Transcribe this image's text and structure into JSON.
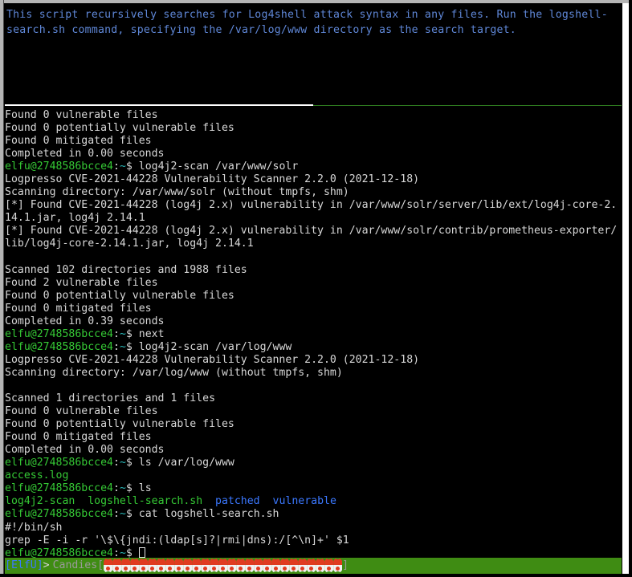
{
  "window": {
    "background_color": "#000000",
    "frame_color": "#b4b4b4",
    "scrollbar_color": "#ffffff"
  },
  "banner": {
    "text": "This script recursively searches for Log4shell attack syntax in any files. Run the logshell-search.sh command, specifying the /var/log/www directory as the search target.",
    "color": "#5f87d7"
  },
  "divider": {
    "left_color": "#ffffff",
    "right_color": "#2f7d20"
  },
  "terminal": {
    "prompt": {
      "user_host": "elfu@2748586bcce4",
      "colon": ":",
      "tilde": "~",
      "dollar": "$ ",
      "user_host_color": "#35c935",
      "tilde_color": "#29b8b8"
    },
    "lines": [
      {
        "type": "out",
        "text": "Found 0 vulnerable files"
      },
      {
        "type": "out",
        "text": "Found 0 potentially vulnerable files"
      },
      {
        "type": "out",
        "text": "Found 0 mitigated files"
      },
      {
        "type": "out",
        "text": "Completed in 0.00 seconds"
      },
      {
        "type": "prompt",
        "command": "log4j2-scan /var/www/solr"
      },
      {
        "type": "out",
        "text": "Logpresso CVE-2021-44228 Vulnerability Scanner 2.2.0 (2021-12-18)"
      },
      {
        "type": "out",
        "text": "Scanning directory: /var/www/solr (without tmpfs, shm)"
      },
      {
        "type": "out",
        "text": "[*] Found CVE-2021-44228 (log4j 2.x) vulnerability in /var/www/solr/server/lib/ext/log4j-core-2.14.1.jar, log4j 2.14.1"
      },
      {
        "type": "out",
        "text": "[*] Found CVE-2021-44228 (log4j 2.x) vulnerability in /var/www/solr/contrib/prometheus-exporter/lib/log4j-core-2.14.1.jar, log4j 2.14.1"
      },
      {
        "type": "blank",
        "text": ""
      },
      {
        "type": "out",
        "text": "Scanned 102 directories and 1988 files"
      },
      {
        "type": "out",
        "text": "Found 2 vulnerable files"
      },
      {
        "type": "out",
        "text": "Found 0 potentially vulnerable files"
      },
      {
        "type": "out",
        "text": "Found 0 mitigated files"
      },
      {
        "type": "out",
        "text": "Completed in 0.39 seconds"
      },
      {
        "type": "prompt",
        "command": "next"
      },
      {
        "type": "prompt",
        "command": "log4j2-scan /var/log/www"
      },
      {
        "type": "out",
        "text": "Logpresso CVE-2021-44228 Vulnerability Scanner 2.2.0 (2021-12-18)"
      },
      {
        "type": "out",
        "text": "Scanning directory: /var/log/www (without tmpfs, shm)"
      },
      {
        "type": "blank",
        "text": ""
      },
      {
        "type": "out",
        "text": "Scanned 1 directories and 1 files"
      },
      {
        "type": "out",
        "text": "Found 0 vulnerable files"
      },
      {
        "type": "out",
        "text": "Found 0 potentially vulnerable files"
      },
      {
        "type": "out",
        "text": "Found 0 mitigated files"
      },
      {
        "type": "out",
        "text": "Completed in 0.00 seconds"
      },
      {
        "type": "prompt",
        "command": "ls /var/log/www"
      },
      {
        "type": "ls",
        "entries": [
          {
            "name": "access.log",
            "kind": "file-green"
          }
        ]
      },
      {
        "type": "prompt",
        "command": "ls"
      },
      {
        "type": "ls",
        "entries": [
          {
            "name": "log4j2-scan",
            "kind": "file-green"
          },
          {
            "name": "logshell-search.sh",
            "kind": "file-green"
          },
          {
            "name": "patched",
            "kind": "dir-blue"
          },
          {
            "name": "vulnerable",
            "kind": "dir-blue"
          }
        ]
      },
      {
        "type": "prompt",
        "command": "cat logshell-search.sh"
      },
      {
        "type": "out",
        "text": "#!/bin/sh"
      },
      {
        "type": "out",
        "text": "grep -E -i -r '\\$\\{jndi:(ldap[s]?|rmi|dns):/[^\\n]+' $1"
      },
      {
        "type": "prompt-cursor",
        "command": ""
      }
    ]
  },
  "statusbar": {
    "session_name": "[ElfU]",
    "arrow": ">",
    "label": "Candies",
    "bracket_open": "[",
    "bracket_close": "]",
    "candy_count": 27,
    "background_color": "#3f8c13",
    "session_color": "#3b78ff"
  }
}
